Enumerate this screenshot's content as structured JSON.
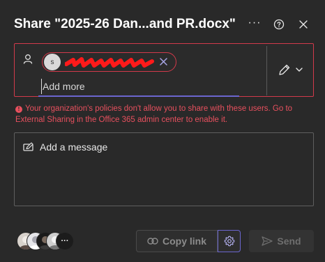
{
  "dialog": {
    "title": "Share \"2025-26 Dan...and PR.docx\"",
    "more_label": "···"
  },
  "recipients": {
    "chip": {
      "initial": "s",
      "name_redacted": true
    },
    "add_more_placeholder": "Add more",
    "error_text": "Your organization's policies don't allow you to share with these users. Go to External Sharing in the Office 365 admin center to enable it."
  },
  "message": {
    "label": "Add a message"
  },
  "footer": {
    "more_people_label": "···",
    "copy_link_label": "Copy link",
    "send_label": "Send"
  },
  "colors": {
    "background": "#292929",
    "error": "#d33a4b",
    "accent": "#6b66cf",
    "redaction": "#ff1a1a"
  }
}
